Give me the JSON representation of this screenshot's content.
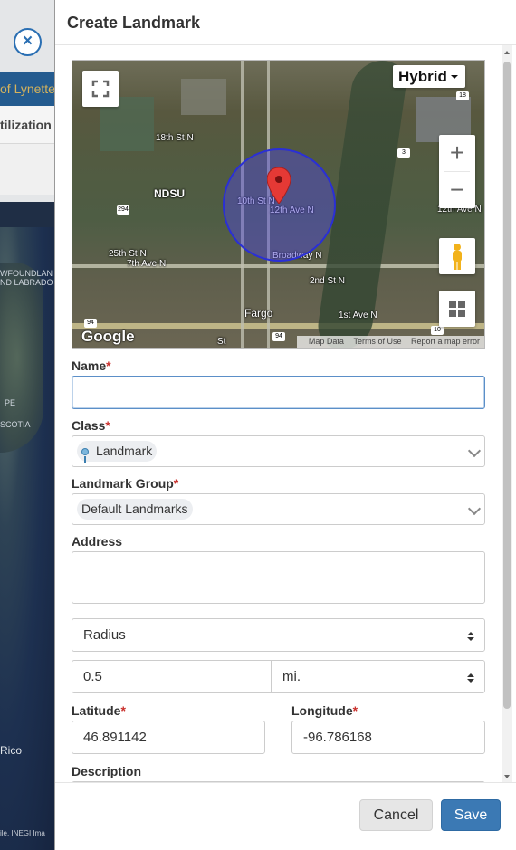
{
  "background": {
    "top_text": "of Lynette",
    "section_text": "tilization",
    "map_labels": [
      "WFOUNDLAN",
      "ND LABRADO",
      "PE",
      "SCOTIA"
    ],
    "rico_label": "Rico",
    "footer_text": "ile, INEGI Ima"
  },
  "modal": {
    "title": "Create Landmark",
    "map": {
      "type_label": "Hybrid",
      "labels": [
        "NDSU",
        "18th St N",
        "10th St N",
        "12th Ave N",
        "7th Ave N",
        "25th St N",
        "Broadway N",
        "2nd St N",
        "1st Ave N",
        "Fargo",
        "12th Ave N",
        "St"
      ],
      "road_shields": [
        "294",
        "18",
        "3",
        "94",
        "94",
        "10"
      ],
      "google": "Google",
      "attribution": [
        "Map Data",
        "Terms of Use",
        "Report a map error"
      ]
    },
    "form": {
      "name_label": "Name",
      "name_value": "",
      "class_label": "Class",
      "class_value": "Landmark",
      "group_label": "Landmark Group",
      "group_value": "Default Landmarks",
      "address_label": "Address",
      "address_value": "",
      "shape_value": "Radius",
      "radius_value": "0.5",
      "unit_value": "mi.",
      "latitude_label": "Latitude",
      "latitude_value": "46.891142",
      "longitude_label": "Longitude",
      "longitude_value": "-96.786168",
      "description_label": "Description",
      "required_mark": "*"
    },
    "footer": {
      "cancel_label": "Cancel",
      "save_label": "Save"
    }
  },
  "colors": {
    "primary": "#3b79b4",
    "required": "#c9302c",
    "circle": "#2a2fd6"
  }
}
